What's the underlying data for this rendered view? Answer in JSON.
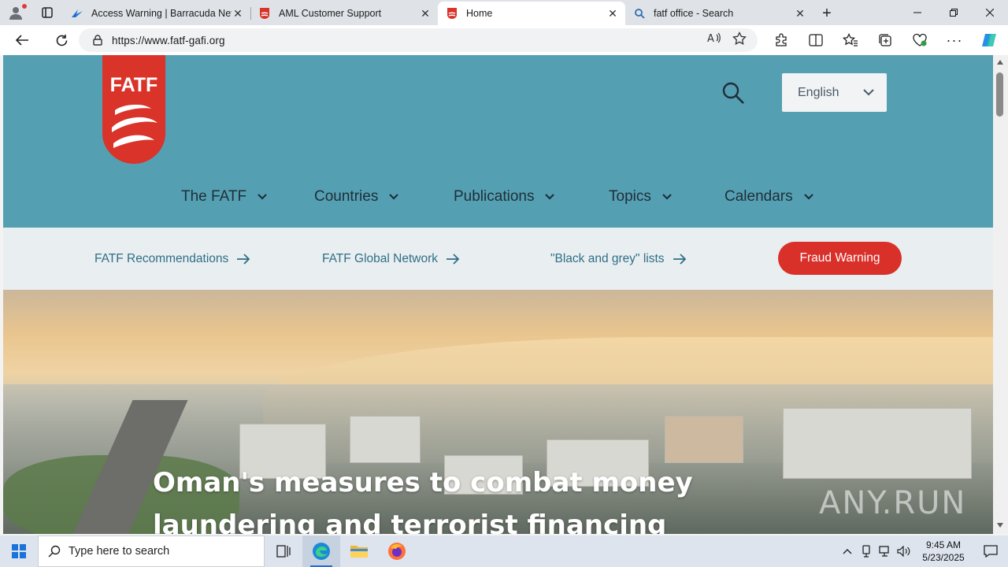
{
  "browser": {
    "tabs": [
      {
        "title": "Access Warning | Barracuda Netw",
        "favicon": "barracuda-icon"
      },
      {
        "title": "AML Customer Support",
        "favicon": "fatf-shield-icon"
      },
      {
        "title": "Home",
        "favicon": "fatf-shield-icon",
        "active": true
      },
      {
        "title": "fatf office - Search",
        "favicon": "search-icon"
      }
    ],
    "url_prefix": "https://",
    "url_host": "www.fatf-gafi.org"
  },
  "page": {
    "logo_text": "FATF",
    "language": "English",
    "nav": [
      "The FATF",
      "Countries",
      "Publications",
      "Topics",
      "Calendars"
    ],
    "quick_links": [
      "FATF Recommendations",
      "FATF Global Network",
      "\"Black and grey\" lists"
    ],
    "fraud_button": "Fraud Warning",
    "hero_title": "Oman's measures to combat money laundering and terrorist financing",
    "watermark": "ANY.RUN"
  },
  "colors": {
    "header": "#559fb3",
    "quickbar": "#e9eef1",
    "fraud": "#d9302a",
    "logo_red": "#d9332a"
  },
  "taskbar": {
    "search_placeholder": "Type here to search",
    "time": "9:45 AM",
    "date": "5/23/2025"
  }
}
